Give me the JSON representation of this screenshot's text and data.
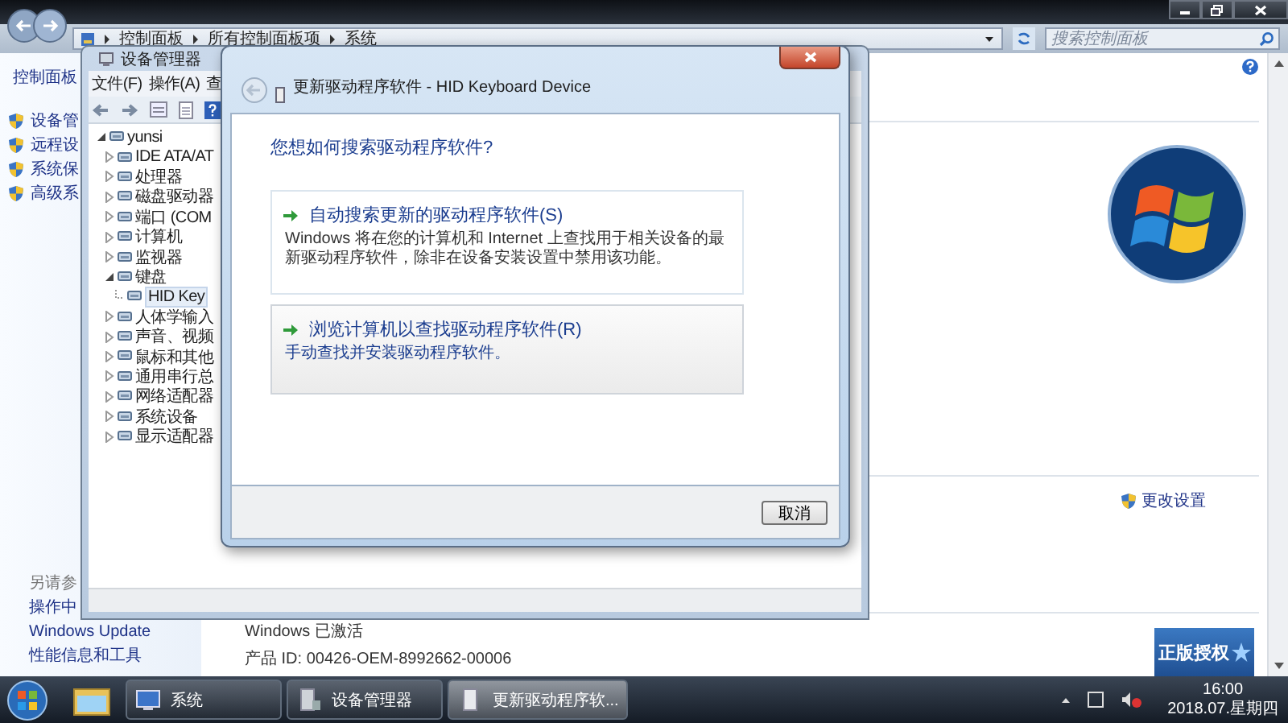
{
  "system_window": {
    "breadcrumb": [
      "控制面板",
      "所有控制面板项",
      "系统"
    ],
    "search": {
      "placeholder": "搜索控制面板"
    },
    "nav_home": "控制面板",
    "nav_items": [
      "设备管",
      "远程设",
      "系统保",
      "高级系"
    ],
    "see_also": {
      "heading": "另请参",
      "links": [
        "操作中",
        "Windows Update",
        "性能信息和工具"
      ]
    },
    "change_settings": "更改设置",
    "activation": "Windows 已激活",
    "product_id": "产品 ID: 00426-OEM-8992662-00006",
    "genuine_badge": "正版授权"
  },
  "device_manager": {
    "title": "设备管理器",
    "menu": [
      "文件(F)",
      "操作(A)",
      "查"
    ],
    "tree": {
      "label": "yunsi",
      "expanded": true,
      "selected": false,
      "children": [
        {
          "label": "IDE ATA/AT",
          "expanded": false,
          "selected": false
        },
        {
          "label": "处理器",
          "expanded": false,
          "selected": false
        },
        {
          "label": "磁盘驱动器",
          "expanded": false,
          "selected": false
        },
        {
          "label": "端口 (COM",
          "expanded": false,
          "selected": false
        },
        {
          "label": "计算机",
          "expanded": false,
          "selected": false
        },
        {
          "label": "监视器",
          "expanded": false,
          "selected": false
        },
        {
          "label": "键盘",
          "expanded": true,
          "selected": false,
          "children": [
            {
              "label": "HID Key",
              "selected": true
            }
          ]
        },
        {
          "label": "人体学输入",
          "expanded": false,
          "selected": false
        },
        {
          "label": "声音、视频",
          "expanded": false,
          "selected": false
        },
        {
          "label": "鼠标和其他",
          "expanded": false,
          "selected": false
        },
        {
          "label": "通用串行总",
          "expanded": false,
          "selected": false
        },
        {
          "label": "网络适配器",
          "expanded": false,
          "selected": false
        },
        {
          "label": "系统设备",
          "expanded": false,
          "selected": false
        },
        {
          "label": "显示适配器",
          "expanded": false,
          "selected": false
        }
      ]
    }
  },
  "dialog": {
    "title": "更新驱动程序软件 - HID Keyboard Device",
    "question": "您想如何搜索驱动程序软件?",
    "options": [
      {
        "title": "自动搜索更新的驱动程序软件(S)",
        "description": "Windows 将在您的计算机和 Internet 上查找用于相关设备的最新驱动程序软件，除非在设备安装设置中禁用该功能。",
        "hovered": false
      },
      {
        "title": "浏览计算机以查找驱动程序软件(R)",
        "description": "手动查找并安装驱动程序软件。",
        "hovered": true
      }
    ],
    "cancel": "取消"
  },
  "taskbar": {
    "tasks": [
      {
        "label": "系统",
        "kind": "system",
        "active": false
      },
      {
        "label": "设备管理器",
        "kind": "devmgr",
        "active": false
      },
      {
        "label": "更新驱动程序软...",
        "kind": "update",
        "active": true
      }
    ],
    "time": "16:00",
    "date": "2018.07.星期四"
  }
}
